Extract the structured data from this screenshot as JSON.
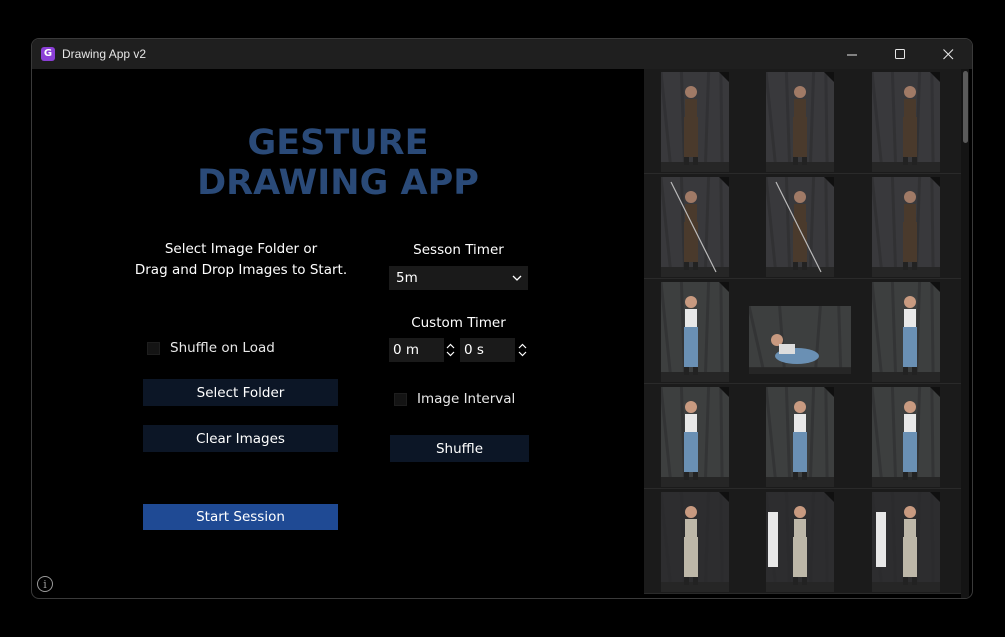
{
  "window": {
    "title": "Drawing App v2",
    "app_icon_letter": "G",
    "controls": [
      "minimize",
      "maximize",
      "close"
    ]
  },
  "heading": "GESTURE DRAWING APP",
  "instructions": {
    "line1": "Select Image Folder or",
    "line2": "Drag and Drop Images to Start."
  },
  "left_panel": {
    "shuffle_on_load_label": "Shuffle on Load",
    "select_folder_label": "Select Folder",
    "clear_images_label": "Clear Images",
    "start_session_label": "Start Session"
  },
  "right_panel": {
    "session_timer_label": "Sesson Timer",
    "session_timer_value": "5m",
    "custom_timer_label": "Custom Timer",
    "minutes_value": "0 m",
    "seconds_value": "0 s",
    "image_interval_label": "Image Interval",
    "shuffle_label": "Shuffle"
  },
  "gallery": {
    "rows": [
      [
        "pose-standing",
        "pose-seated-stool",
        "pose-leaning-chair"
      ],
      [
        "pose-spear-raised",
        "pose-spear-hold",
        "pose-standing-hands"
      ],
      [
        "pose-arm-raised",
        "pose-floor-seated",
        "pose-chair-lean"
      ],
      [
        "pose-chair-seated",
        "pose-standing-front",
        "pose-hand-on-hip"
      ],
      [
        "pose-standing-white-top",
        "pose-walking-window",
        "pose-standing-window"
      ]
    ]
  },
  "colors": {
    "heading": "#2a4a78",
    "button_dark": "#0c1626",
    "button_primary": "#1f4a94",
    "titlebar": "#1f1f1f",
    "app_icon": "#8b3fd6"
  },
  "icons": {
    "info": "info-circle-icon",
    "dropdown": "chevron-down-icon",
    "spin": "spin-arrows-icon"
  }
}
